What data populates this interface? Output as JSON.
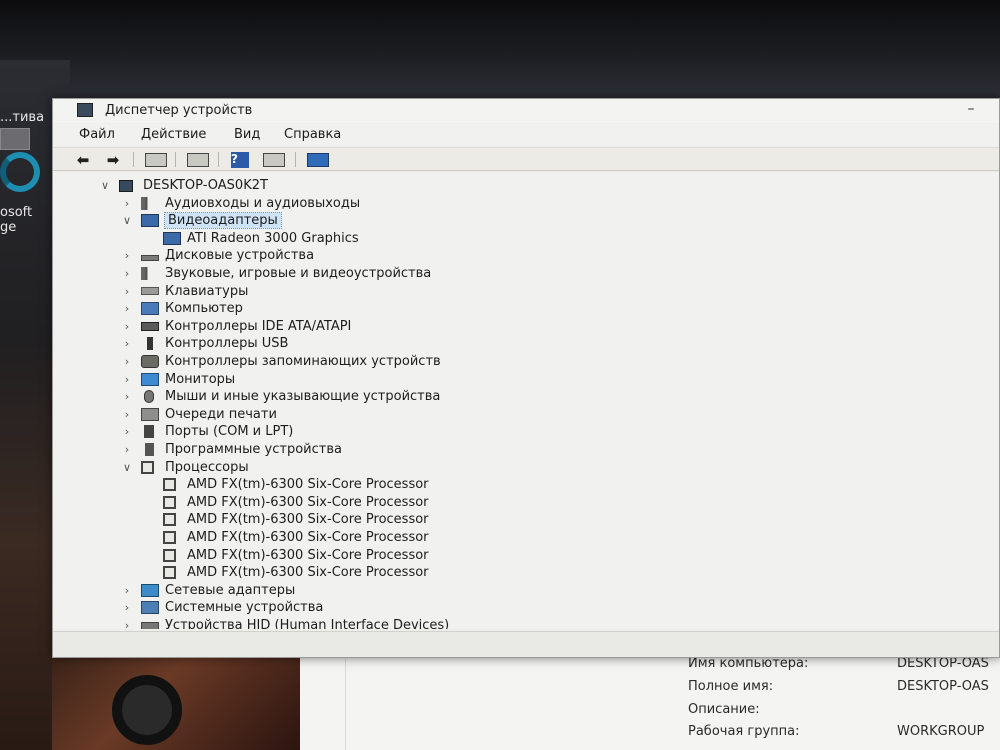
{
  "desktop": {
    "icon_label_1": "...тива",
    "icon_label_2": "osoft",
    "icon_label_3": "ge"
  },
  "window": {
    "title": "Диспетчер устройств",
    "minimize_label": "–"
  },
  "menu": {
    "items": [
      "Файл",
      "Действие",
      "Вид",
      "Справка"
    ]
  },
  "toolbar": {
    "back_icon": "arrow-left-icon",
    "forward_icon": "arrow-right-icon",
    "help_label": "?"
  },
  "tree": {
    "root": "DESKTOP-OAS0K2T",
    "items": [
      {
        "label": "Аудиовходы и аудиовыходы",
        "icon": "speaker-icon",
        "expanded": false
      },
      {
        "label": "Видеоадаптеры",
        "icon": "display-adapter-icon",
        "expanded": true,
        "selected": true,
        "children": [
          "ATI Radeon 3000 Graphics"
        ]
      },
      {
        "label": "Дисковые устройства",
        "icon": "disk-icon",
        "expanded": false
      },
      {
        "label": "Звуковые, игровые и видеоустройства",
        "icon": "speaker-icon",
        "expanded": false
      },
      {
        "label": "Клавиатуры",
        "icon": "keyboard-icon",
        "expanded": false
      },
      {
        "label": "Компьютер",
        "icon": "computer-icon",
        "expanded": false
      },
      {
        "label": "Контроллеры IDE ATA/ATAPI",
        "icon": "ide-icon",
        "expanded": false
      },
      {
        "label": "Контроллеры USB",
        "icon": "usb-icon",
        "expanded": false
      },
      {
        "label": "Контроллеры запоминающих устройств",
        "icon": "storage-icon",
        "expanded": false
      },
      {
        "label": "Мониторы",
        "icon": "monitor-icon",
        "expanded": false
      },
      {
        "label": "Мыши и иные указывающие устройства",
        "icon": "mouse-icon",
        "expanded": false
      },
      {
        "label": "Очереди печати",
        "icon": "printer-icon",
        "expanded": false
      },
      {
        "label": "Порты (COM и LPT)",
        "icon": "port-icon",
        "expanded": false
      },
      {
        "label": "Программные устройства",
        "icon": "software-device-icon",
        "expanded": false
      },
      {
        "label": "Процессоры",
        "icon": "cpu-icon",
        "expanded": true,
        "children": [
          "AMD FX(tm)-6300 Six-Core Processor",
          "AMD FX(tm)-6300 Six-Core Processor",
          "AMD FX(tm)-6300 Six-Core Processor",
          "AMD FX(tm)-6300 Six-Core Processor",
          "AMD FX(tm)-6300 Six-Core Processor",
          "AMD FX(tm)-6300 Six-Core Processor"
        ]
      },
      {
        "label": "Сетевые адаптеры",
        "icon": "network-icon",
        "expanded": false
      },
      {
        "label": "Системные устройства",
        "icon": "system-device-icon",
        "expanded": false
      },
      {
        "label": "Устройства HID (Human Interface Devices)",
        "icon": "hid-icon",
        "expanded": false
      }
    ]
  },
  "system_info": {
    "rows": [
      {
        "label": "Имя компьютера:",
        "value": "DESKTOP-OAS"
      },
      {
        "label": "Полное имя:",
        "value": "DESKTOP-OAS"
      },
      {
        "label": "Описание:",
        "value": ""
      },
      {
        "label": "Рабочая группа:",
        "value": "WORKGROUP"
      }
    ]
  }
}
